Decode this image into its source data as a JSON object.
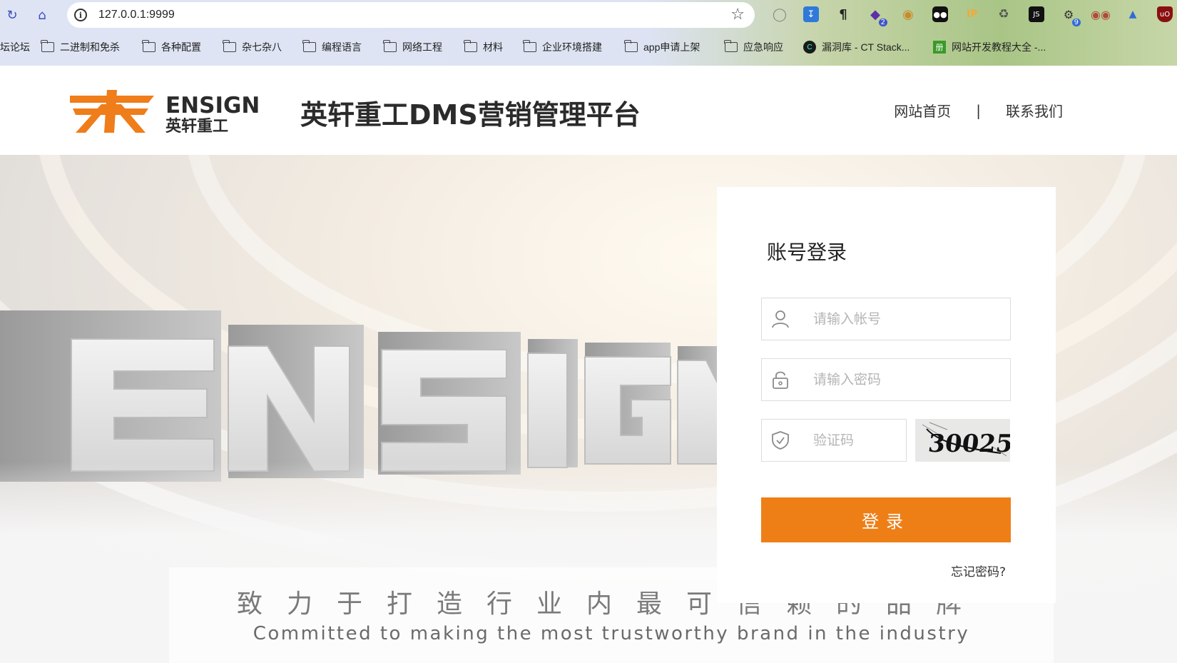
{
  "browser": {
    "url": "127.0.0.1:9999",
    "bookmarks": [
      {
        "label": "坛论坛",
        "type": "partial"
      },
      {
        "label": "二进制和免杀",
        "type": "folder"
      },
      {
        "label": "各种配置",
        "type": "folder"
      },
      {
        "label": "杂七杂八",
        "type": "folder"
      },
      {
        "label": "编程语言",
        "type": "folder"
      },
      {
        "label": "网络工程",
        "type": "folder"
      },
      {
        "label": "材料",
        "type": "folder"
      },
      {
        "label": "企业环境搭建",
        "type": "folder"
      },
      {
        "label": "app申请上架",
        "type": "folder"
      },
      {
        "label": "应急响应",
        "type": "folder"
      },
      {
        "label": "漏洞库 - CT Stack...",
        "type": "link",
        "icon": "ct-stack-icon"
      },
      {
        "label": "网站开发教程大全 -...",
        "type": "link",
        "icon": "green-book-icon"
      }
    ],
    "extensions": {
      "badge_2": "2",
      "badge_9": "9",
      "ip_label": "IP",
      "js_label": "JS"
    }
  },
  "header": {
    "logo_text_en": "ENSIGN",
    "logo_text_cn": "英轩重工",
    "title": "英轩重工DMS营销管理平台",
    "nav": {
      "home": "网站首页",
      "separator": "|",
      "contact": "联系我们"
    }
  },
  "hero": {
    "wordmark": "ENSIGN",
    "slogan_cn": "致力于打造行业内最可信赖的品牌",
    "slogan_en": "Committed to making the most  trustworthy brand in the industry"
  },
  "login": {
    "title": "账号登录",
    "username_placeholder": "请输入帐号",
    "password_placeholder": "请输入密码",
    "captcha_placeholder": "验证码",
    "captcha_text": "30025",
    "submit_label": "登录",
    "forgot_label": "忘记密码?"
  },
  "colors": {
    "accent": "#ee7f17",
    "logo_orange": "#ef7d1a",
    "text_dark": "#2b2b2b"
  }
}
